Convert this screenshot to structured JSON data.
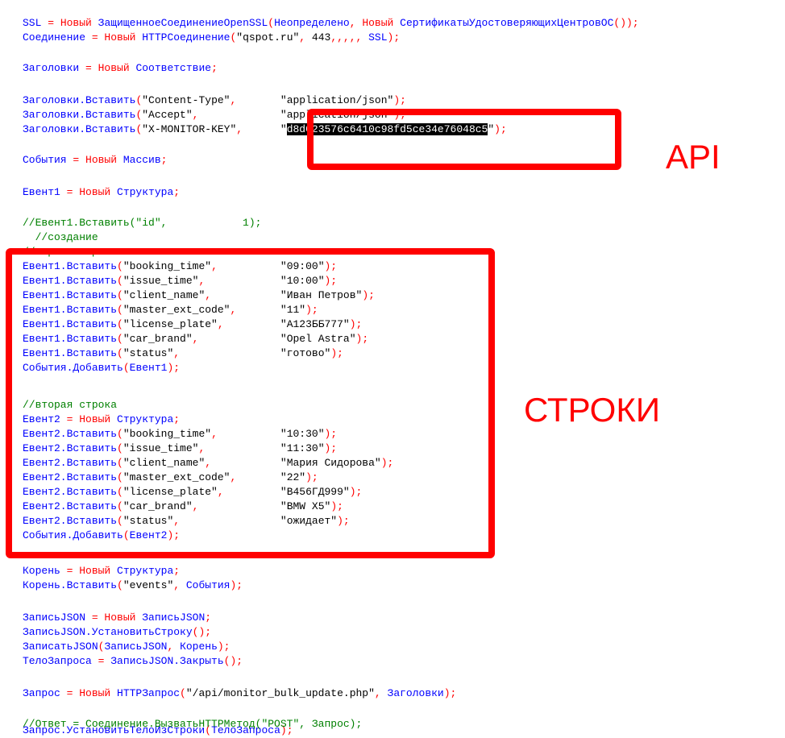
{
  "colors": {
    "identifier": "#0000ff",
    "keyword": "#ff0000",
    "literal": "#000000",
    "comment": "#008000",
    "selection_bg": "#000000",
    "selection_fg": "#ffffff",
    "annotation": "#ff0000"
  },
  "annotations": {
    "api_label": "API",
    "rows_label": "СТРОКИ"
  },
  "code_lines": [
    {
      "tokens": [
        [
          "blue",
          "SSL "
        ],
        [
          "red",
          "= Новый "
        ],
        [
          "blue",
          "ЗащищенноеСоединениеOpenSSL"
        ],
        [
          "red",
          "("
        ],
        [
          "blue",
          "Неопределено"
        ],
        [
          "red",
          ", Новый "
        ],
        [
          "blue",
          "СертификатыУдостоверяющихЦентровОС"
        ],
        [
          "red",
          "());"
        ]
      ]
    },
    {
      "tokens": [
        [
          "blue",
          "Соединение "
        ],
        [
          "red",
          "= Новый "
        ],
        [
          "blue",
          "HTTPСоединение"
        ],
        [
          "red",
          "("
        ],
        [
          "black",
          "\"qspot.ru\""
        ],
        [
          "red",
          ", "
        ],
        [
          "black",
          "443"
        ],
        [
          "red",
          ",,,,, "
        ],
        [
          "blue",
          "SSL"
        ],
        [
          "red",
          ");"
        ]
      ]
    },
    {
      "tokens": []
    },
    {
      "tokens": [
        [
          "blue",
          "Заголовки "
        ],
        [
          "red",
          "= Новый "
        ],
        [
          "blue",
          "Соответствие"
        ],
        [
          "red",
          ";"
        ]
      ]
    },
    {
      "tokens": []
    },
    {
      "tokens": [
        [
          "blue",
          "Заголовки.Вставить"
        ],
        [
          "red",
          "("
        ],
        [
          "black",
          "\"Content-Type\""
        ],
        [
          "red",
          ",       "
        ],
        [
          "black",
          "\"application/json\""
        ],
        [
          "red",
          ");"
        ]
      ]
    },
    {
      "tokens": [
        [
          "blue",
          "Заголовки.Вставить"
        ],
        [
          "red",
          "("
        ],
        [
          "black",
          "\"Accept\""
        ],
        [
          "red",
          ",             "
        ],
        [
          "black",
          "\"application/json\""
        ],
        [
          "red",
          ");"
        ]
      ]
    },
    {
      "tokens": [
        [
          "blue",
          "Заголовки.Вставить"
        ],
        [
          "red",
          "("
        ],
        [
          "black",
          "\"X-MONITOR-KEY\""
        ],
        [
          "red",
          ",      "
        ],
        [
          "black",
          "\""
        ],
        [
          "sel",
          "d8d023576c6410c98fd5ce34e76048c5"
        ],
        [
          "black",
          "\""
        ],
        [
          "red",
          ");"
        ]
      ]
    },
    {
      "tokens": []
    },
    {
      "tokens": [
        [
          "blue",
          "События "
        ],
        [
          "red",
          "= Новый "
        ],
        [
          "blue",
          "Массив"
        ],
        [
          "red",
          ";"
        ]
      ]
    },
    {
      "tokens": []
    },
    {
      "tokens": [
        [
          "blue",
          "Евент1 "
        ],
        [
          "red",
          "= Новый "
        ],
        [
          "blue",
          "Структура"
        ],
        [
          "red",
          ";"
        ]
      ]
    },
    {
      "tokens": []
    },
    {
      "tokens": [
        [
          "green",
          "//Евент1.Вставить(\"id\",            1);"
        ]
      ]
    },
    {
      "tokens": [
        [
          "green",
          "  //создание"
        ]
      ]
    },
    {
      "tokens": [
        [
          "green",
          "//первая строка"
        ]
      ]
    },
    {
      "tokens": [
        [
          "blue",
          "Евент1.Вставить"
        ],
        [
          "red",
          "("
        ],
        [
          "black",
          "\"booking_time\""
        ],
        [
          "red",
          ",          "
        ],
        [
          "black",
          "\"09:00\""
        ],
        [
          "red",
          ");"
        ]
      ]
    },
    {
      "tokens": [
        [
          "blue",
          "Евент1.Вставить"
        ],
        [
          "red",
          "("
        ],
        [
          "black",
          "\"issue_time\""
        ],
        [
          "red",
          ",            "
        ],
        [
          "black",
          "\"10:00\""
        ],
        [
          "red",
          ");"
        ]
      ]
    },
    {
      "tokens": [
        [
          "blue",
          "Евент1.Вставить"
        ],
        [
          "red",
          "("
        ],
        [
          "black",
          "\"client_name\""
        ],
        [
          "red",
          ",           "
        ],
        [
          "black",
          "\"Иван Петров\""
        ],
        [
          "red",
          ");"
        ]
      ]
    },
    {
      "tokens": [
        [
          "blue",
          "Евент1.Вставить"
        ],
        [
          "red",
          "("
        ],
        [
          "black",
          "\"master_ext_code\""
        ],
        [
          "red",
          ",       "
        ],
        [
          "black",
          "\"11\""
        ],
        [
          "red",
          ");"
        ]
      ]
    },
    {
      "tokens": [
        [
          "blue",
          "Евент1.Вставить"
        ],
        [
          "red",
          "("
        ],
        [
          "black",
          "\"license_plate\""
        ],
        [
          "red",
          ",         "
        ],
        [
          "black",
          "\"А123ББ777\""
        ],
        [
          "red",
          ");"
        ]
      ]
    },
    {
      "tokens": [
        [
          "blue",
          "Евент1.Вставить"
        ],
        [
          "red",
          "("
        ],
        [
          "black",
          "\"car_brand\""
        ],
        [
          "red",
          ",             "
        ],
        [
          "black",
          "\"Opel Astra\""
        ],
        [
          "red",
          ");"
        ]
      ]
    },
    {
      "tokens": [
        [
          "blue",
          "Евент1.Вставить"
        ],
        [
          "red",
          "("
        ],
        [
          "black",
          "\"status\""
        ],
        [
          "red",
          ",                "
        ],
        [
          "black",
          "\"готово\""
        ],
        [
          "red",
          ");"
        ]
      ]
    },
    {
      "tokens": [
        [
          "blue",
          "События.Добавить"
        ],
        [
          "red",
          "("
        ],
        [
          "blue",
          "Евент1"
        ],
        [
          "red",
          ");"
        ]
      ]
    },
    {
      "tokens": []
    },
    {
      "tokens": [
        [
          "green",
          "//вторая строка"
        ]
      ]
    },
    {
      "tokens": [
        [
          "blue",
          "Евент2 "
        ],
        [
          "red",
          "= Новый "
        ],
        [
          "blue",
          "Структура"
        ],
        [
          "red",
          ";"
        ]
      ]
    },
    {
      "tokens": [
        [
          "blue",
          "Евент2.Вставить"
        ],
        [
          "red",
          "("
        ],
        [
          "black",
          "\"booking_time\""
        ],
        [
          "red",
          ",          "
        ],
        [
          "black",
          "\"10:30\""
        ],
        [
          "red",
          ");"
        ]
      ]
    },
    {
      "tokens": [
        [
          "blue",
          "Евент2.Вставить"
        ],
        [
          "red",
          "("
        ],
        [
          "black",
          "\"issue_time\""
        ],
        [
          "red",
          ",            "
        ],
        [
          "black",
          "\"11:30\""
        ],
        [
          "red",
          ");"
        ]
      ]
    },
    {
      "tokens": [
        [
          "blue",
          "Евент2.Вставить"
        ],
        [
          "red",
          "("
        ],
        [
          "black",
          "\"client_name\""
        ],
        [
          "red",
          ",           "
        ],
        [
          "black",
          "\"Мария Сидорова\""
        ],
        [
          "red",
          ");"
        ]
      ]
    },
    {
      "tokens": [
        [
          "blue",
          "Евент2.Вставить"
        ],
        [
          "red",
          "("
        ],
        [
          "black",
          "\"master_ext_code\""
        ],
        [
          "red",
          ",       "
        ],
        [
          "black",
          "\"22\""
        ],
        [
          "red",
          ");"
        ]
      ]
    },
    {
      "tokens": [
        [
          "blue",
          "Евент2.Вставить"
        ],
        [
          "red",
          "("
        ],
        [
          "black",
          "\"license_plate\""
        ],
        [
          "red",
          ",         "
        ],
        [
          "black",
          "\"В456ГД999\""
        ],
        [
          "red",
          ");"
        ]
      ]
    },
    {
      "tokens": [
        [
          "blue",
          "Евент2.Вставить"
        ],
        [
          "red",
          "("
        ],
        [
          "black",
          "\"car_brand\""
        ],
        [
          "red",
          ",             "
        ],
        [
          "black",
          "\"BMW X5\""
        ],
        [
          "red",
          ");"
        ]
      ]
    },
    {
      "tokens": [
        [
          "blue",
          "Евент2.Вставить"
        ],
        [
          "red",
          "("
        ],
        [
          "black",
          "\"status\""
        ],
        [
          "red",
          ",                "
        ],
        [
          "black",
          "\"ожидает\""
        ],
        [
          "red",
          ");"
        ]
      ]
    },
    {
      "tokens": [
        [
          "blue",
          "События.Добавить"
        ],
        [
          "red",
          "("
        ],
        [
          "blue",
          "Евент2"
        ],
        [
          "red",
          ");"
        ]
      ]
    },
    {
      "tokens": []
    },
    {
      "tokens": [
        [
          "blue",
          "Корень "
        ],
        [
          "red",
          "= Новый "
        ],
        [
          "blue",
          "Структура"
        ],
        [
          "red",
          ";"
        ]
      ]
    },
    {
      "tokens": [
        [
          "blue",
          "Корень.Вставить"
        ],
        [
          "red",
          "("
        ],
        [
          "black",
          "\"events\""
        ],
        [
          "red",
          ", "
        ],
        [
          "blue",
          "События"
        ],
        [
          "red",
          ");"
        ]
      ]
    },
    {
      "tokens": []
    },
    {
      "tokens": [
        [
          "blue",
          "ЗаписьJSON "
        ],
        [
          "red",
          "= Новый "
        ],
        [
          "blue",
          "ЗаписьJSON"
        ],
        [
          "red",
          ";"
        ]
      ]
    },
    {
      "tokens": [
        [
          "blue",
          "ЗаписьJSON.УстановитьСтроку"
        ],
        [
          "red",
          "();"
        ]
      ]
    },
    {
      "tokens": [
        [
          "blue",
          "ЗаписатьJSON"
        ],
        [
          "red",
          "("
        ],
        [
          "blue",
          "ЗаписьJSON"
        ],
        [
          "red",
          ", "
        ],
        [
          "blue",
          "Корень"
        ],
        [
          "red",
          ");"
        ]
      ]
    },
    {
      "tokens": [
        [
          "blue",
          "ТелоЗапроса "
        ],
        [
          "red",
          "= "
        ],
        [
          "blue",
          "ЗаписьJSON.Закрыть"
        ],
        [
          "red",
          "();"
        ]
      ]
    },
    {
      "tokens": []
    },
    {
      "tokens": [
        [
          "blue",
          "Запрос "
        ],
        [
          "red",
          "= Новый "
        ],
        [
          "blue",
          "HTTPЗапрос"
        ],
        [
          "red",
          "("
        ],
        [
          "black",
          "\"/api/monitor_bulk_update.php\""
        ],
        [
          "red",
          ", "
        ],
        [
          "blue",
          "Заголовки"
        ],
        [
          "red",
          ");"
        ]
      ]
    },
    {
      "tokens": []
    },
    {
      "tokens": [
        [
          "blue",
          "Запрос.УстановитьТелоИзСтроки"
        ],
        [
          "red",
          "("
        ],
        [
          "blue",
          "ТелоЗапроса"
        ],
        [
          "red",
          ");"
        ]
      ]
    },
    {
      "tokens": [
        [
          "green",
          "//Ответ = Соединение.ВызватьHTTPМетод(\"POST\", Запрос);"
        ]
      ]
    }
  ]
}
